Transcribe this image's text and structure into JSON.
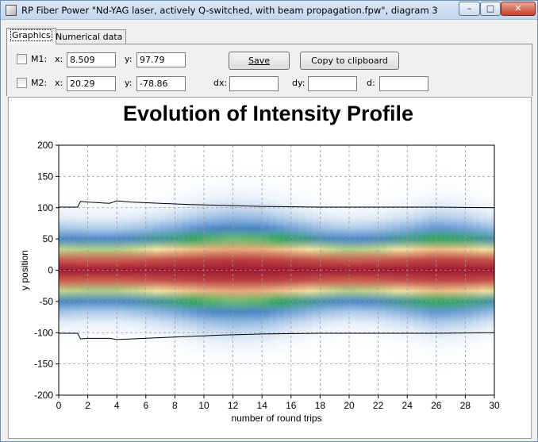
{
  "window": {
    "title": "RP Fiber Power \"Nd-YAG laser, actively Q-switched, with beam propagation.fpw\", diagram 3",
    "icon": "app-icon",
    "minimize_glyph": "–",
    "maximize_glyph": "□",
    "close_glyph": "✕"
  },
  "tabs": [
    {
      "label": "Graphics",
      "active": true
    },
    {
      "label": "Numerical data",
      "active": false
    }
  ],
  "markers": {
    "m1": {
      "label": "M1:",
      "checked": false,
      "x_label": "x:",
      "x": "8.509",
      "y_label": "y:",
      "y": "97.79"
    },
    "m2": {
      "label": "M2:",
      "checked": false,
      "x_label": "x:",
      "x": "20.29",
      "y_label": "y:",
      "y": "-78.86"
    }
  },
  "buttons": {
    "save_label": "Save",
    "copy_label": "Copy to clipboard"
  },
  "diffs": {
    "dx_label": "dx:",
    "dx": "",
    "dy_label": "dy:",
    "dy": "",
    "d_label": "d:",
    "d": ""
  },
  "chart_data": {
    "type": "heatmap",
    "title": "Evolution of Intensity Profile",
    "xlabel": "number of round trips",
    "ylabel": "y position",
    "xlim": [
      0,
      30
    ],
    "ylim": [
      -200,
      200
    ],
    "xticks": [
      0,
      2,
      4,
      6,
      8,
      10,
      12,
      14,
      16,
      18,
      20,
      22,
      24,
      26,
      28,
      30
    ],
    "yticks": [
      200,
      150,
      100,
      50,
      0,
      -50,
      -100,
      -150,
      -200
    ],
    "grid": true,
    "colormap": [
      "#ffffff",
      "#9ec0e4",
      "#4a86c8",
      "#2fa85a",
      "#f2e3a0",
      "#e08060",
      "#a01830"
    ],
    "beam_width_curve": {
      "x": [
        0,
        1.3,
        1.5,
        2,
        3.5,
        4,
        5,
        7,
        9,
        11,
        14,
        18,
        22,
        26,
        30
      ],
      "upper": [
        101,
        101,
        110,
        109,
        107,
        111,
        109,
        107,
        105,
        104,
        102,
        101,
        101,
        101,
        100
      ],
      "lower": [
        -101,
        -101,
        -110,
        -109,
        -109,
        -111,
        -110,
        -108,
        -106,
        -104,
        -102,
        -101,
        -101,
        -101,
        -100
      ]
    },
    "profile_width": {
      "x": [
        0,
        2,
        4,
        6,
        8,
        10,
        12,
        14,
        16,
        18,
        20,
        22,
        24,
        26,
        28,
        30
      ],
      "half_width": [
        60,
        58,
        58,
        62,
        68,
        76,
        80,
        78,
        70,
        62,
        58,
        60,
        66,
        74,
        70,
        62
      ]
    }
  }
}
